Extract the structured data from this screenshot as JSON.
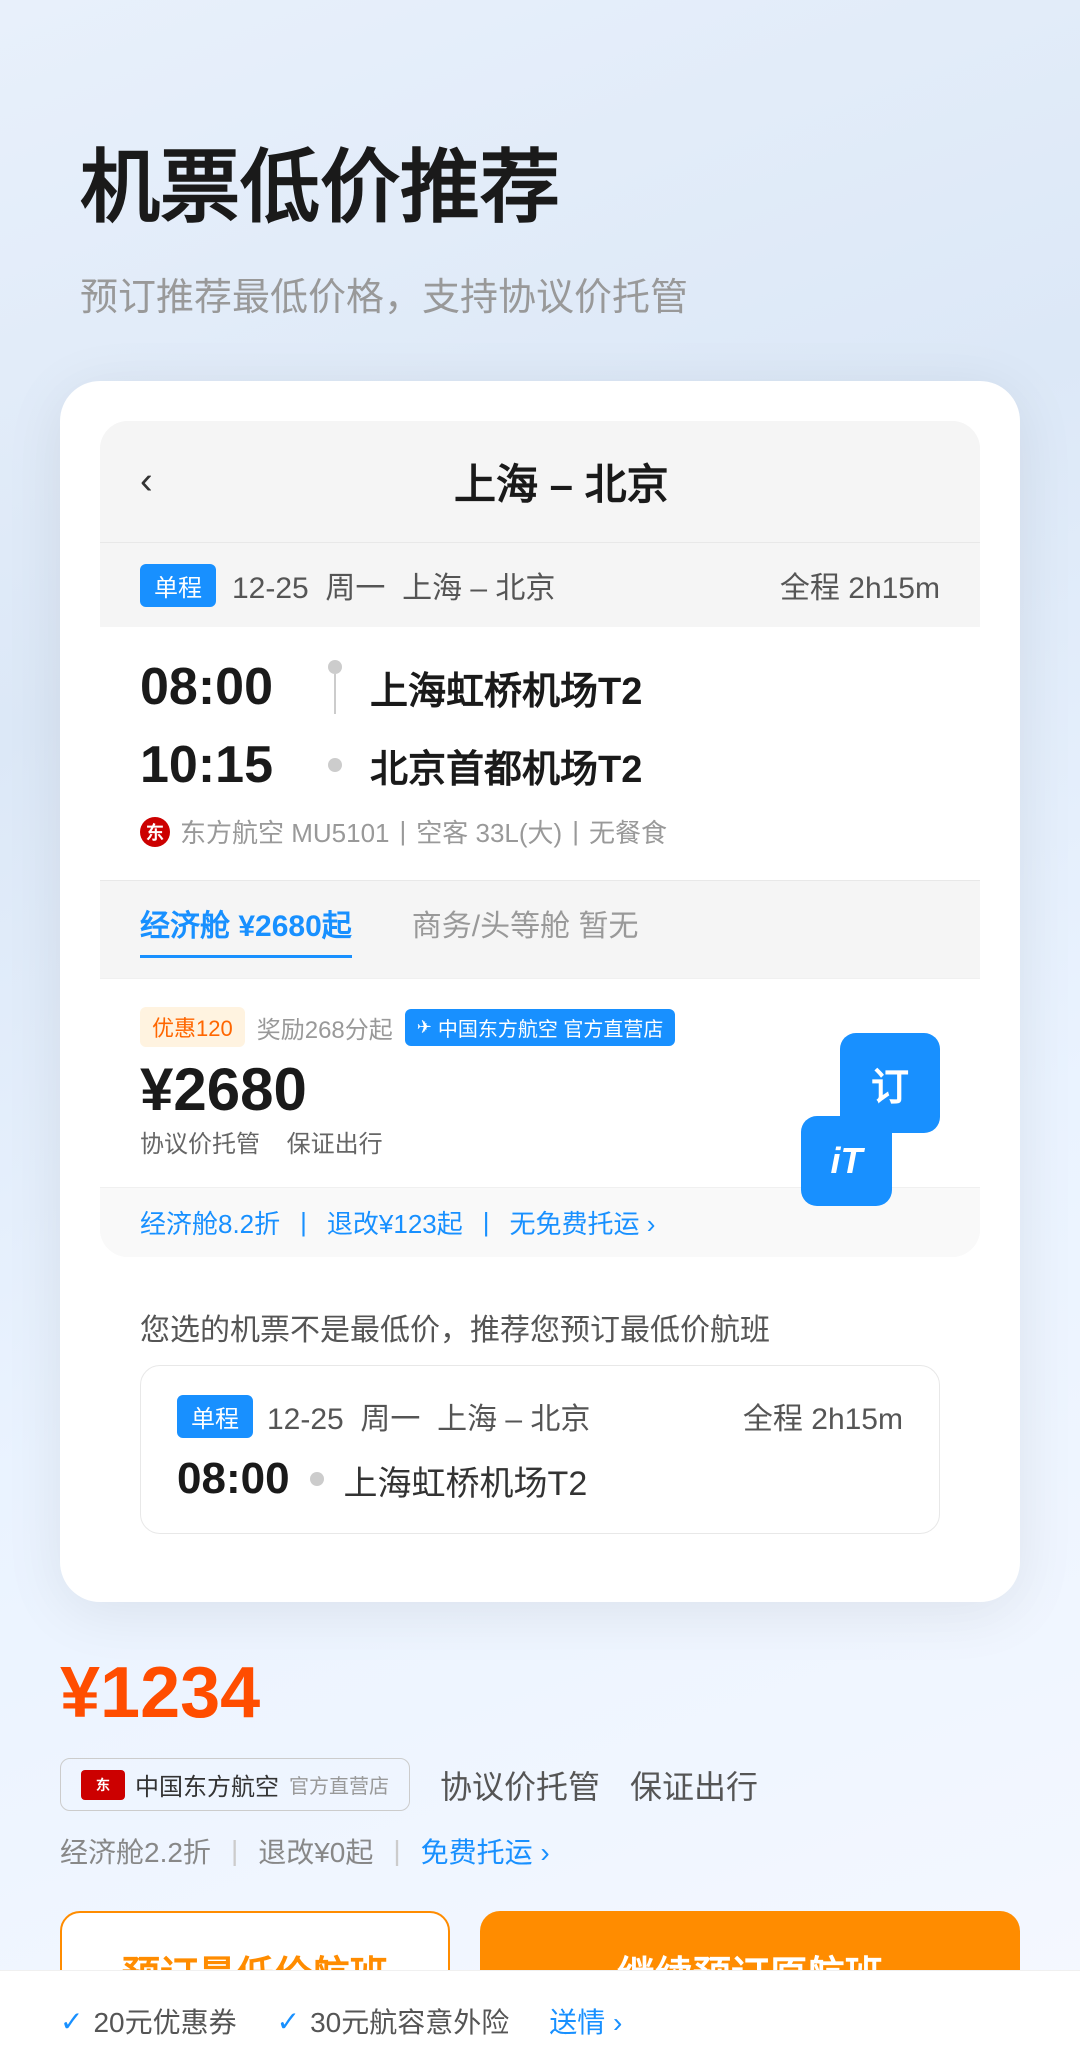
{
  "header": {
    "title": "机票低价推荐",
    "subtitle": "预订推荐最低价格，支持协议价托管"
  },
  "flightCard": {
    "backBtn": "‹",
    "route": "上海 – 北京",
    "tripType": "单程",
    "date": "12-25",
    "weekday": "周一",
    "routeShort": "上海 – 北京",
    "duration": "全程 2h15m",
    "departure": {
      "time": "08:00",
      "airport": "上海虹桥机场T2"
    },
    "arrival": {
      "time": "10:15",
      "airport": "北京首都机场T2"
    },
    "airline": "东方航空 MU5101",
    "aircraft": "空客 33L(大)",
    "meal": "无餐食",
    "economyCabin": "经济舱",
    "economyPrice": "¥2680起",
    "businessCabin": "商务/头等舱",
    "businessStatus": "暂无",
    "price": "¥2680",
    "discountBadge": "优惠120",
    "pointsBadge": "奖励268分起",
    "airlineBadge": "中国东方航空 官方直营店",
    "orderBtn": "订",
    "managedPrice": "协议价托管",
    "guarantee": "保证出行",
    "discountInfo": "经济舱8.2折",
    "changeInfo": "退改¥123起",
    "luggageInfo": "无免费托运 ›"
  },
  "recommendation": {
    "notice": "您选的机票不是最低价，推荐您预订最低价航班",
    "miniCard": {
      "tripType": "单程",
      "date": "12-25",
      "weekday": "周一",
      "route": "上海 – 北京",
      "duration": "全程 2h15m",
      "time": "08:00",
      "airport": "上海虹桥机场T2"
    }
  },
  "bottomSection": {
    "price": "¥1234",
    "pricePrefix": "¥",
    "priceNumber": "1234",
    "airlineName": "中国东方航空",
    "airlineSubtext": "官方直营店",
    "tag1": "协议价托管",
    "tag2": "保证出行",
    "discount": "经济舱2.2折",
    "change": "退改¥0起",
    "luggage": "免费托运 ›",
    "btn1": "预订最低价航班",
    "btn2": "继续预订原航班"
  },
  "footerPromo": {
    "item1": "✓ 20元优惠券",
    "item2": "✓ 30元航容意外险",
    "moreLink": "送情 ›"
  },
  "itLogo": "iT"
}
